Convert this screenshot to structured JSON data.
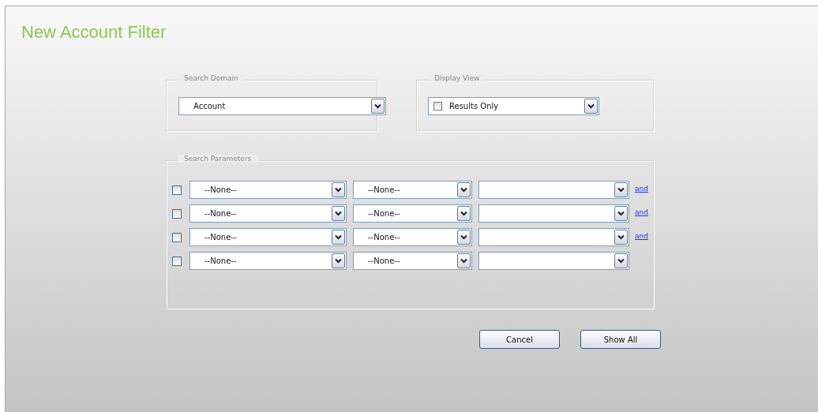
{
  "title": "New Account Filter",
  "search_domain": {
    "legend": "Search Domain",
    "value": "Account"
  },
  "display_view": {
    "legend": "Display View",
    "value": "Results Only",
    "checked": false
  },
  "search_parameters": {
    "legend": "Search Parameters",
    "rows": [
      {
        "checked": false,
        "field": "--None--",
        "operator": "--None--",
        "value": "",
        "link": "and"
      },
      {
        "checked": false,
        "field": "--None--",
        "operator": "--None--",
        "value": "",
        "link": "and"
      },
      {
        "checked": false,
        "field": "--None--",
        "operator": "--None--",
        "value": "",
        "link": "and"
      },
      {
        "checked": false,
        "field": "--None--",
        "operator": "--None--",
        "value": ""
      }
    ]
  },
  "buttons": [
    "Cancel",
    "Show All"
  ]
}
